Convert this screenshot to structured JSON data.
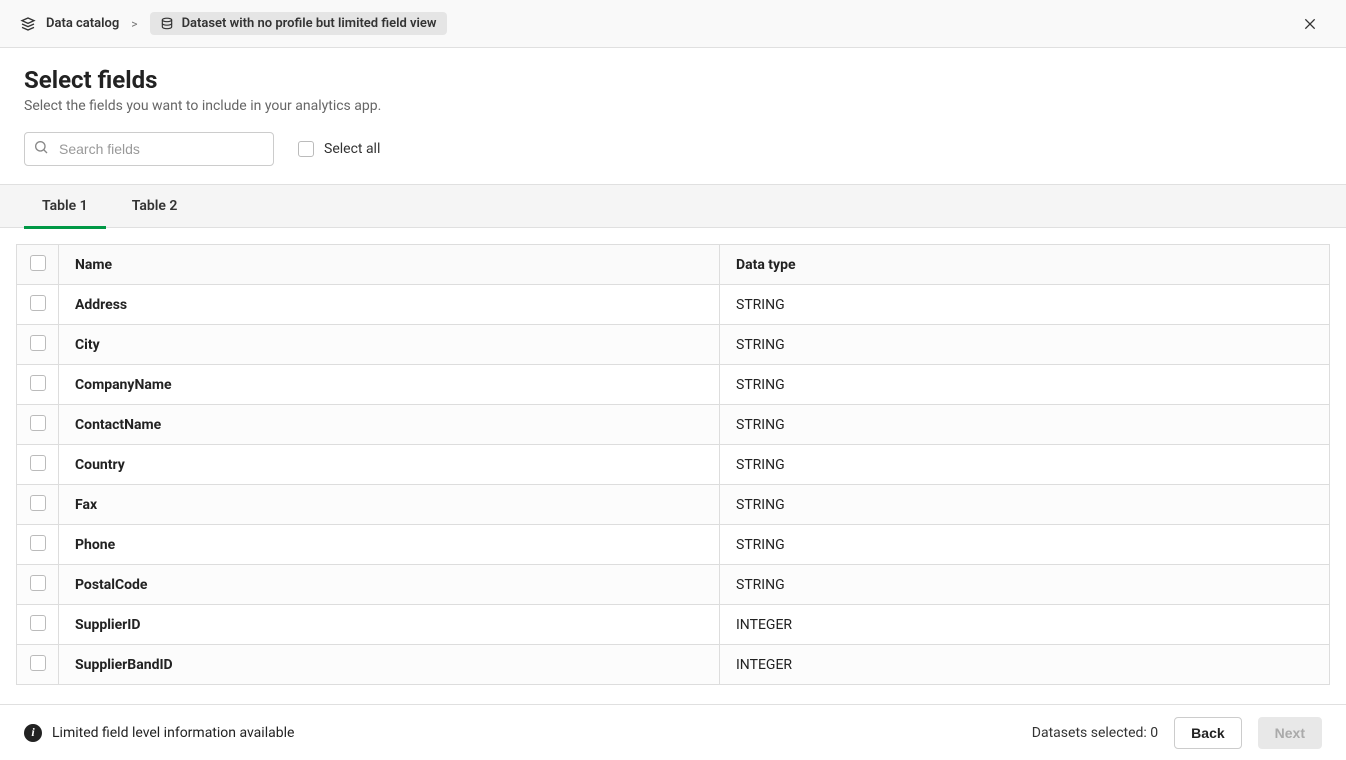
{
  "breadcrumb": {
    "catalog_label": "Data catalog",
    "separator": ">",
    "dataset_label": "Dataset with no profile but limited field view"
  },
  "header": {
    "title": "Select fields",
    "subtitle": "Select the fields you want to include in your analytics app."
  },
  "search": {
    "placeholder": "Search fields",
    "value": ""
  },
  "select_all": {
    "label": "Select all",
    "checked": false
  },
  "tabs": [
    {
      "label": "Table 1",
      "active": true
    },
    {
      "label": "Table 2",
      "active": false
    }
  ],
  "table": {
    "columns": {
      "name": "Name",
      "type": "Data type"
    },
    "rows": [
      {
        "name": "Address",
        "type": "STRING",
        "checked": false
      },
      {
        "name": "City",
        "type": "STRING",
        "checked": false
      },
      {
        "name": "CompanyName",
        "type": "STRING",
        "checked": false
      },
      {
        "name": "ContactName",
        "type": "STRING",
        "checked": false
      },
      {
        "name": "Country",
        "type": "STRING",
        "checked": false
      },
      {
        "name": "Fax",
        "type": "STRING",
        "checked": false
      },
      {
        "name": "Phone",
        "type": "STRING",
        "checked": false
      },
      {
        "name": "PostalCode",
        "type": "STRING",
        "checked": false
      },
      {
        "name": "SupplierID",
        "type": "INTEGER",
        "checked": false
      },
      {
        "name": "SupplierBandID",
        "type": "INTEGER",
        "checked": false
      }
    ]
  },
  "footer": {
    "info_message": "Limited field level information available",
    "datasets_selected_label": "Datasets selected: 0",
    "back_label": "Back",
    "next_label": "Next"
  }
}
